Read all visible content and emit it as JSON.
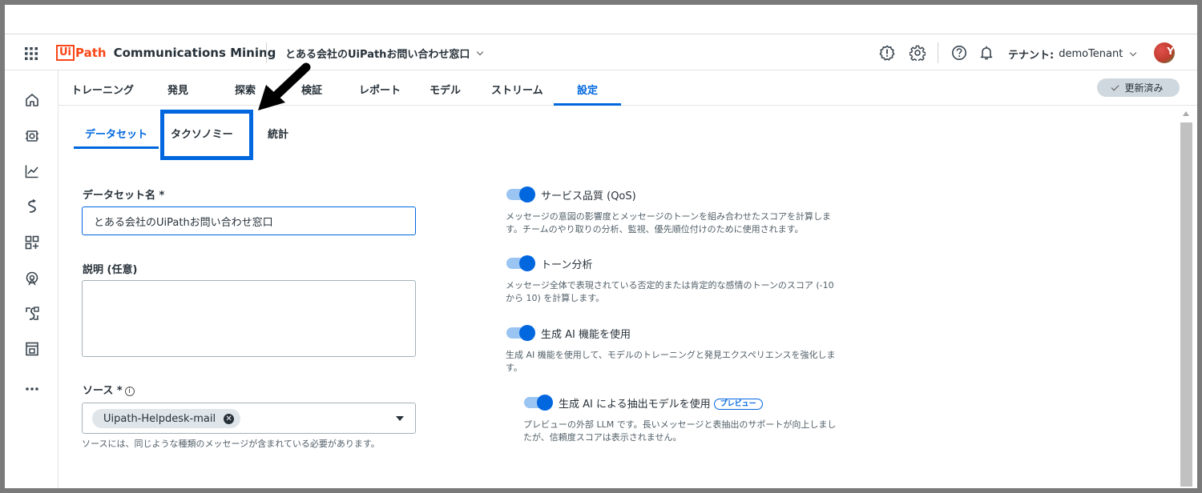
{
  "header": {
    "product_logo_ui": "Ui",
    "product_logo_path": "Path",
    "product_name": "Communications Mining",
    "dataset_name": "とある会社のUiPathお問い合わせ窓口",
    "tenant_label": "テナント:",
    "tenant_value": "demoTenant",
    "avatar_initial": "Y"
  },
  "tabs": [
    "トレーニング",
    "発見",
    "探索",
    "検証",
    "レポート",
    "モデル",
    "ストリーム",
    "設定"
  ],
  "active_tab": "設定",
  "status_badge": "更新済み",
  "subtabs": [
    "データセット",
    "タクソノミー",
    "統計"
  ],
  "active_subtab": "データセット",
  "form": {
    "name_label": "データセット名 *",
    "name_value": "とある会社のUiPathお問い合わせ窓口",
    "description_label": "説明 (任意)",
    "description_value": "",
    "source_label": "ソース *",
    "source_chip": "Uipath-Helpdesk-mail",
    "source_helper": "ソースには、同じような種類のメッセージが含まれている必要があります。"
  },
  "toggles": [
    {
      "title": "サービス品質 (QoS)",
      "on": true,
      "desc_line1": "メッセージの意図の影響度とメッセージのトーンを組み合わせたスコアを計算しま",
      "desc_line2": "す。チームのやり取りの分析、監視、優先順位付けのために使用されます。"
    },
    {
      "title": "トーン分析",
      "on": true,
      "desc_line1": "メッセージ全体で表現されている否定的または肯定的な感情のトーンのスコア (-10",
      "desc_line2": "から 10) を計算します。"
    },
    {
      "title": "生成 AI 機能を使用",
      "on": true,
      "desc_line1": "生成 AI 機能を使用して、モデルのトレーニングと発見エクスペリエンスを強化しま",
      "desc_line2": "す。"
    },
    {
      "title": "生成 AI による抽出モデルを使用",
      "badge": "プレビュー",
      "on": true,
      "desc_line1": "プレビューの外部 LLM です。長いメッセージと表抽出のサポートが向上しまし",
      "desc_line2": "たが、信頼度スコアは表示されません。"
    }
  ],
  "colors": {
    "accent": "#0067df",
    "brand": "#fa4616",
    "toggle_track": "#9ac4f2",
    "badge_bg": "#cfd8de"
  },
  "icons": {
    "header": [
      "apps-grid-icon",
      "alert-icon",
      "settings-gear-icon",
      "help-icon",
      "bell-icon"
    ],
    "rail": [
      "home-icon",
      "training-icon",
      "analytics-icon",
      "integration-icon",
      "apps-add-icon",
      "stream-icon",
      "connections-icon",
      "resources-icon",
      "more-icon"
    ]
  }
}
